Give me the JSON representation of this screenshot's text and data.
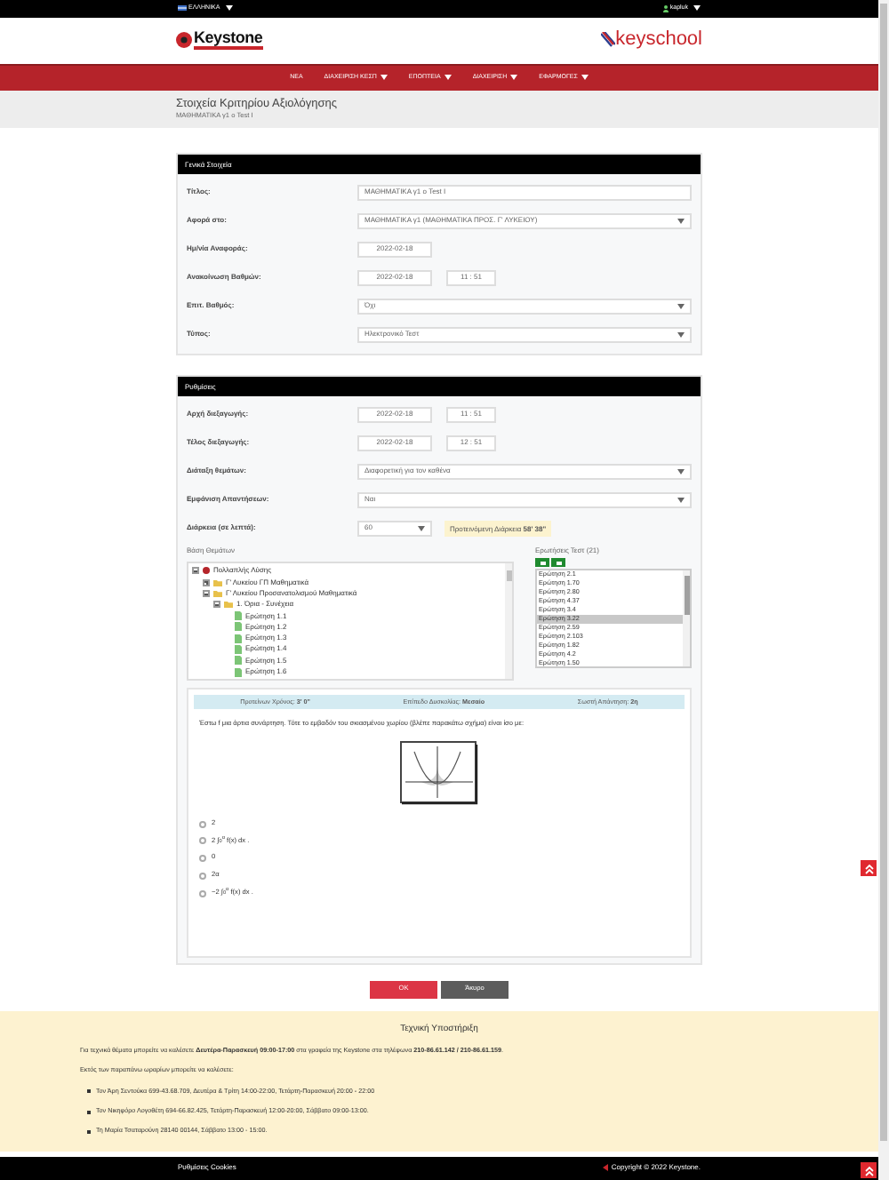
{
  "top_bar": {
    "language": "ΕΛΛΗΝΙΚΑ",
    "user": "kapluk"
  },
  "header": {
    "logo_left": "Keystone",
    "logo_right": "keyschool"
  },
  "nav": [
    {
      "label": "ΝΕΑ",
      "dropdown": false
    },
    {
      "label": "ΔΙΑΧΕΙΡΙΣΗ ΚΕΣΠ",
      "dropdown": true
    },
    {
      "label": "ΕΠΟΠΤΕΙΑ",
      "dropdown": true
    },
    {
      "label": "ΔΙΑΧΕΙΡΙΣΗ",
      "dropdown": true
    },
    {
      "label": "ΕΦΑΡΜΟΓΕΣ",
      "dropdown": true
    }
  ],
  "page": {
    "title": "Στοιχεία Κριτηρίου Αξιολόγησης",
    "subtitle": "ΜΑΘΗΜΑΤΙΚΑ γ1 ο Test I"
  },
  "general": {
    "heading": "Γενικά Στοιχεία",
    "fields": [
      {
        "kind": "text",
        "label": "Τίτλος:",
        "value": "ΜΑΘΗΜΑΤΙΚΑ γ1 ο Test I"
      },
      {
        "kind": "select",
        "label": "Αφορά στο:",
        "value": "ΜΑΘΗΜΑΤΙΚΑ γ1 (ΜΑΘΗΜΑΤΙΚΑ ΠΡΟΣ. Γ' ΛΥΚΕΙΟΥ)"
      },
      {
        "kind": "date",
        "label": "Ημ/νία Αναφοράς:",
        "value": "2022-02-18"
      },
      {
        "kind": "datetime",
        "label": "Ανακοίνωση Βαθμών:",
        "value": "2022-02-18",
        "time": "11 : 51"
      },
      {
        "kind": "select",
        "label": "Επιτ. Βαθμός:",
        "value": "Όχι"
      },
      {
        "kind": "select",
        "label": "Τύπος:",
        "value": "Ηλεκτρονικό Τεστ"
      }
    ]
  },
  "settings": {
    "heading": "Ρυθμίσεις",
    "fields": [
      {
        "kind": "datetime",
        "label": "Αρχή διεξαγωγής:",
        "value": "2022-02-18",
        "time": "11 : 51"
      },
      {
        "kind": "datetime",
        "label": "Τέλος διεξαγωγής:",
        "value": "2022-02-18",
        "time": "12 : 51"
      },
      {
        "kind": "select",
        "label": "Διάταξη θεμάτων:",
        "value": "Διαφορετική για τον καθένα"
      },
      {
        "kind": "select",
        "label": "Εμφάνιση Απαντήσεων:",
        "value": "Ναι"
      },
      {
        "kind": "duration",
        "label": "Διάρκεια (σε λεπτά):",
        "value": "60",
        "note": "Προτεινόμενη Διάρκεια **58' 38\"**"
      }
    ]
  },
  "question_bank": {
    "heading": "Βάση Θεμάτων",
    "tree": [
      {
        "label": "Πολλαπλής Λύσης",
        "expanded": true,
        "children": [
          {
            "label": "Γ' Λυκείου ΓΠ Μαθηματικά",
            "expanded": false
          },
          {
            "label": "Γ' Λυκείου Προσανατολισμού Μαθηματικά",
            "expanded": true,
            "children": [
              {
                "label": "1. Όρια - Συνέχεια",
                "expanded": true,
                "children": [
                  {
                    "label": "Ερώτηση 1.1"
                  },
                  {
                    "label": "Ερώτηση 1.2"
                  },
                  {
                    "label": "Ερώτηση 1.3"
                  },
                  {
                    "label": "Ερώτηση 1.4"
                  },
                  {
                    "label": "Ερώτηση 1.5"
                  },
                  {
                    "label": "Ερώτηση 1.6"
                  }
                ]
              }
            ]
          }
        ]
      }
    ]
  },
  "test_questions": {
    "heading": "Ερωτήσεις Τεστ (21)",
    "items": [
      {
        "label": "Ερώτηση 2.1",
        "selected": false
      },
      {
        "label": "Ερώτηση 1.70",
        "selected": false
      },
      {
        "label": "Ερώτηση 2.80",
        "selected": false
      },
      {
        "label": "Ερώτηση 4.37",
        "selected": false
      },
      {
        "label": "Ερώτηση 3.4",
        "selected": false
      },
      {
        "label": "Ερώτηση 3.22",
        "selected": true
      },
      {
        "label": "Ερώτηση 2.59",
        "selected": false
      },
      {
        "label": "Ερώτηση 2.103",
        "selected": false
      },
      {
        "label": "Ερώτηση 1.82",
        "selected": false
      },
      {
        "label": "Ερώτηση 4.2",
        "selected": false
      },
      {
        "label": "Ερώτηση 1.50",
        "selected": false
      }
    ]
  },
  "preview": {
    "info": [
      "Προτείνων Χρόνος: **3' 0\"**",
      "Επίπεδο Δυσκολίας: **Μεσαίο**",
      "Σωστή Απάντηση: **2η**"
    ],
    "question": "Έστω f μια άρτια συνάρτηση. Τότε το εμβαδόν του σκιασμένου χωρίου (βλέπε παρακάτω σχήμα) είναι ίσο με:",
    "options": [
      {
        "text": "2",
        "selected": false
      },
      {
        "text": "2 ∫$_{0}$$^{α}$ f(x) dx .",
        "selected": false
      },
      {
        "text": "0",
        "selected": false
      },
      {
        "text": "2α",
        "selected": false
      },
      {
        "text": "−2 ∫$_{0}$$^{α}$ f(x) dx .",
        "selected": false
      }
    ]
  },
  "buttons": [
    {
      "label": "OK",
      "kind": "primary"
    },
    {
      "label": "Άκυρο",
      "kind": "secondary"
    }
  ],
  "support": {
    "title": "Τεχνική Υποστήριξη",
    "text": "Για τεχνικά θέματα μπορείτε να καλέσετε **Δευτέρα-Παρασκευή 09:00-17:00** στα γραφεία της Keystone στα τηλέφωνα **210-86.61.142 / 210-86.61.159**.",
    "extra": "Εκτός των παραπάνω ωραρίων μπορείτε να καλέσετε:",
    "contacts": [
      "Τον Άρη Σεντούκα 699-43.68.709, Δευτέρα & Τρίτη 14:00-22:00, Τετάρτη-Παρασκευή 20:00 - 22:00",
      "Τον Νικηφόρο Λογοθέτη 694-66.82.425, Τετάρτη-Παρασκευή 12:00-20:00, Σάββατο 09:00-13:00.",
      "Τη Μαρία Τσαταρούνη 28140 00144, Σάββατο 13:00 - 15:00."
    ]
  },
  "footer": {
    "cookies": "Ρυθμίσεις Cookies",
    "copyright": "Copyright © 2022 Keystone."
  }
}
